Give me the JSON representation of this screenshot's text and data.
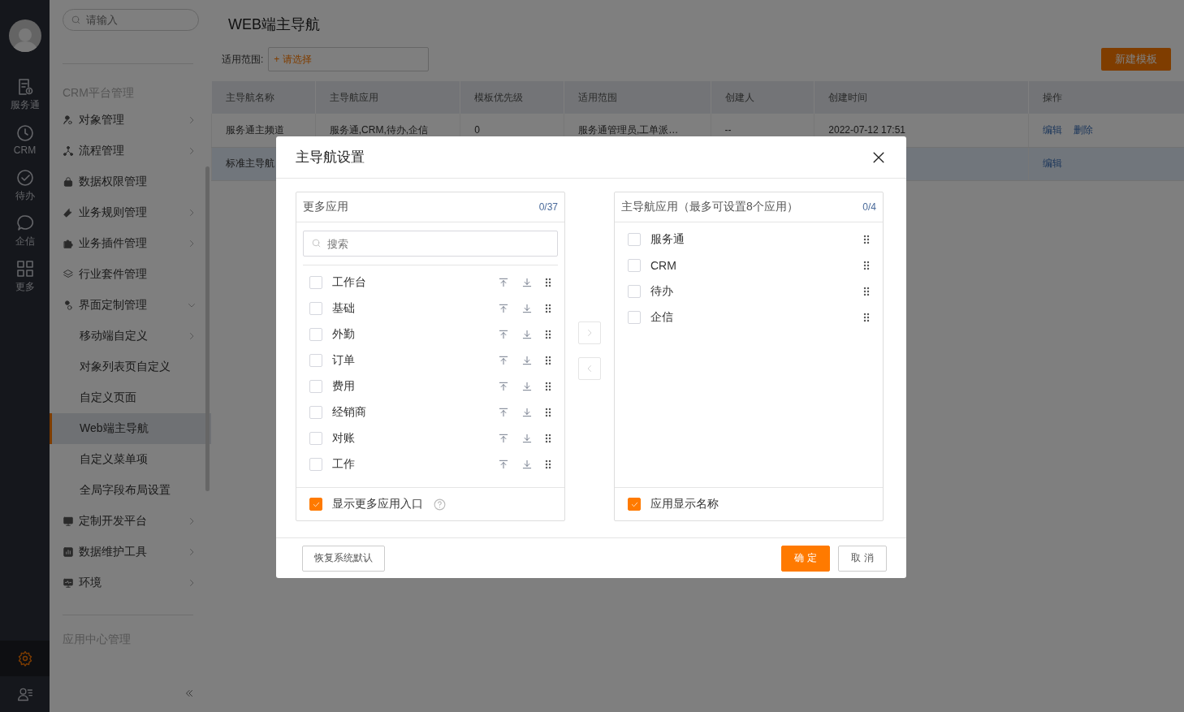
{
  "rail": {
    "items": [
      {
        "label": "服务通",
        "selected": false
      },
      {
        "label": "CRM",
        "selected": false
      },
      {
        "label": "待办",
        "selected": false
      },
      {
        "label": "企信",
        "selected": false
      },
      {
        "label": "更多",
        "selected": false
      }
    ],
    "bottom": [
      {
        "selected": true
      },
      {
        "selected": false
      }
    ]
  },
  "sidebar": {
    "search": {
      "placeholder": "请输入"
    },
    "section": "CRM平台管理",
    "items": [
      {
        "label": "对象管理",
        "kind": "group",
        "expanded": false,
        "selected": false
      },
      {
        "label": "流程管理",
        "kind": "group",
        "expanded": false,
        "selected": false
      },
      {
        "label": "数据权限管理",
        "kind": "leaf",
        "selected": false
      },
      {
        "label": "业务规则管理",
        "kind": "group",
        "expanded": false,
        "selected": false
      },
      {
        "label": "业务插件管理",
        "kind": "group",
        "expanded": false,
        "selected": false
      },
      {
        "label": "行业套件管理",
        "kind": "leaf",
        "selected": false
      },
      {
        "label": "界面定制管理",
        "kind": "group",
        "expanded": true,
        "selected": false,
        "children": [
          {
            "label": "移动端自定义",
            "kind": "group",
            "expanded": false,
            "selected": false
          },
          {
            "label": "对象列表页自定义",
            "kind": "leaf",
            "selected": false
          },
          {
            "label": "自定义页面",
            "kind": "leaf",
            "selected": false
          },
          {
            "label": "Web端主导航",
            "kind": "leaf",
            "selected": true
          },
          {
            "label": "自定义菜单项",
            "kind": "leaf",
            "selected": false
          },
          {
            "label": "全局字段布局设置",
            "kind": "leaf",
            "selected": false
          }
        ]
      },
      {
        "label": "定制开发平台",
        "kind": "group",
        "expanded": false,
        "selected": false
      },
      {
        "label": "数据维护工具",
        "kind": "group",
        "expanded": false,
        "selected": false
      },
      {
        "label": "环境",
        "kind": "group",
        "expanded": false,
        "selected": false
      }
    ],
    "section_2": "应用中心管理"
  },
  "page": {
    "title": "WEB端主导航",
    "filter_label": "适用范围:",
    "filter_picker": "+ 请选择",
    "new_button": "新建模板",
    "table": {
      "columns": [
        "主导航名称",
        "主导航应用",
        "模板优先级",
        "适用范围",
        "创建人",
        "创建时间",
        "操作"
      ],
      "rows": [
        {
          "selected": false,
          "cells": [
            "服务通主频道",
            "服务通,CRM,待办,企信",
            "0",
            "服务通管理员,工单派…",
            "--",
            "2022-07-12 17:51"
          ],
          "actions": [
            "编辑",
            "删除"
          ]
        },
        {
          "selected": true,
          "cells": [
            "标准主导航"
          ],
          "actions": [
            "编辑"
          ]
        }
      ]
    }
  },
  "dialog": {
    "title": "主导航设置",
    "left": {
      "title": "更多应用",
      "count": "0/37",
      "search": {
        "placeholder": "搜索"
      },
      "items": [
        {
          "label": "工作台",
          "checked": false
        },
        {
          "label": "基础",
          "checked": false
        },
        {
          "label": "外勤",
          "checked": false
        },
        {
          "label": "订单",
          "checked": false
        },
        {
          "label": "费用",
          "checked": false
        },
        {
          "label": "经销商",
          "checked": false
        },
        {
          "label": "对账",
          "checked": false
        },
        {
          "label": "工作",
          "checked": false
        }
      ],
      "footer": {
        "label": "显示更多应用入口",
        "checked": true
      }
    },
    "right": {
      "title": "主导航应用（最多可设置8个应用）",
      "count": "0/4",
      "items": [
        {
          "label": "服务通",
          "checked": false
        },
        {
          "label": "CRM",
          "checked": false
        },
        {
          "label": "待办",
          "checked": false
        },
        {
          "label": "企信",
          "checked": false
        }
      ],
      "footer": {
        "label": "应用显示名称",
        "checked": true
      }
    },
    "reset_button": "恢复系统默认",
    "ok_button": "确 定",
    "cancel_button": "取 消"
  }
}
